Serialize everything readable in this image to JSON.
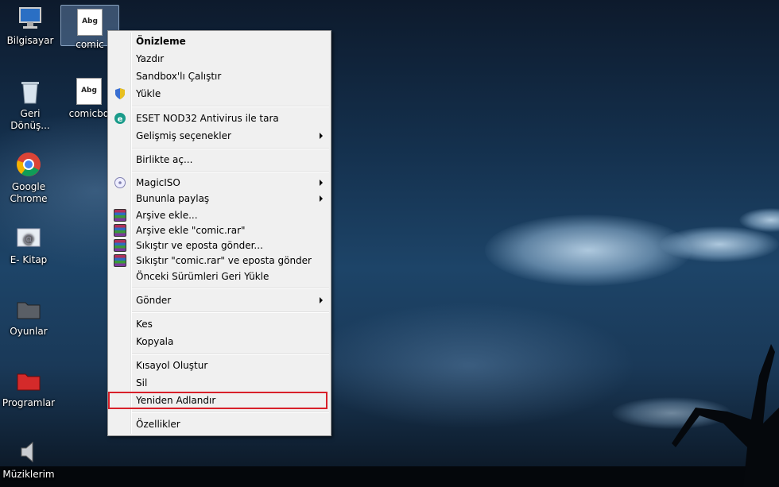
{
  "desktop": {
    "icons": [
      {
        "label": "Bilgisayar"
      },
      {
        "label": "comic"
      },
      {
        "label": "Geri Dönüş..."
      },
      {
        "label": "comicbd"
      },
      {
        "label": "Google Chrome"
      },
      {
        "label": "E- Kitap"
      },
      {
        "label": "Oyunlar"
      },
      {
        "label": "Programlar"
      },
      {
        "label": "Müziklerim"
      }
    ],
    "font_preview_text": "Abg"
  },
  "context_menu": {
    "items": [
      {
        "label": "Önizleme"
      },
      {
        "label": "Yazdır"
      },
      {
        "label": "Sandbox'lı Çalıştır"
      },
      {
        "label": "Yükle"
      },
      {
        "label": "ESET NOD32 Antivirus ile tara"
      },
      {
        "label": "Gelişmiş seçenekler"
      },
      {
        "label": "Birlikte aç..."
      },
      {
        "label": "MagicISO"
      },
      {
        "label": "Bununla paylaş"
      },
      {
        "label": "Arşive ekle..."
      },
      {
        "label": "Arşive ekle \"comic.rar\""
      },
      {
        "label": "Sıkıştır ve eposta gönder..."
      },
      {
        "label": "Sıkıştır \"comic.rar\" ve eposta gönder"
      },
      {
        "label": "Önceki Sürümleri Geri Yükle"
      },
      {
        "label": "Gönder"
      },
      {
        "label": "Kes"
      },
      {
        "label": "Kopyala"
      },
      {
        "label": "Kısayol Oluştur"
      },
      {
        "label": "Sil"
      },
      {
        "label": "Yeniden Adlandır"
      },
      {
        "label": "Özellikler"
      }
    ],
    "highlight_color": "#d8202a"
  }
}
